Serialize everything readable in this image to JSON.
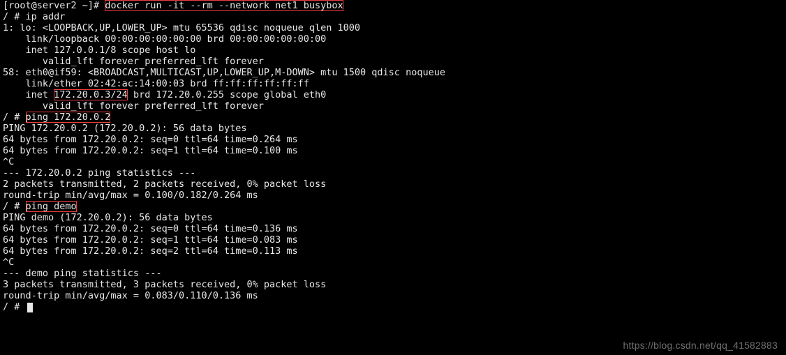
{
  "prompt": {
    "root": "[root@server2 ~]# ",
    "shell": "/ # "
  },
  "cmd": {
    "docker_run": "docker run -it --rm --network net1 busybox",
    "ip_addr": "ip addr",
    "ping_ip": "ping 172.20.0.2",
    "ping_name": "ping demo"
  },
  "ip_addr_output": {
    "lo_header": "1: lo: <LOOPBACK,UP,LOWER_UP> mtu 65536 qdisc noqueue qlen 1000",
    "lo_link": "    link/loopback 00:00:00:00:00:00 brd 00:00:00:00:00:00",
    "lo_inet": "    inet 127.0.0.1/8 scope host lo",
    "lo_valid": "       valid_lft forever preferred_lft forever",
    "eth_header": "58: eth0@if59: <BROADCAST,MULTICAST,UP,LOWER_UP,M-DOWN> mtu 1500 qdisc noqueue",
    "eth_link": "    link/ether 02:42:ac:14:00:03 brd ff:ff:ff:ff:ff:ff",
    "eth_inet_pre": "    inet ",
    "eth_inet_addr": "172.20.0.3/24",
    "eth_inet_post": " brd 172.20.0.255 scope global eth0",
    "eth_valid": "       valid_lft forever preferred_lft forever"
  },
  "ping1": {
    "header": "PING 172.20.0.2 (172.20.0.2): 56 data bytes",
    "r0": "64 bytes from 172.20.0.2: seq=0 ttl=64 time=0.264 ms",
    "r1": "64 bytes from 172.20.0.2: seq=1 ttl=64 time=0.100 ms",
    "break": "^C",
    "stats_hdr": "--- 172.20.0.2 ping statistics ---",
    "stats_pkt": "2 packets transmitted, 2 packets received, 0% packet loss",
    "stats_rtt": "round-trip min/avg/max = 0.100/0.182/0.264 ms"
  },
  "ping2": {
    "header": "PING demo (172.20.0.2): 56 data bytes",
    "r0": "64 bytes from 172.20.0.2: seq=0 ttl=64 time=0.136 ms",
    "r1": "64 bytes from 172.20.0.2: seq=1 ttl=64 time=0.083 ms",
    "r2": "64 bytes from 172.20.0.2: seq=2 ttl=64 time=0.113 ms",
    "break": "^C",
    "stats_hdr": "--- demo ping statistics ---",
    "stats_pkt": "3 packets transmitted, 3 packets received, 0% packet loss",
    "stats_rtt": "round-trip min/avg/max = 0.083/0.110/0.136 ms"
  },
  "watermark": "https://blog.csdn.net/qq_41582883"
}
